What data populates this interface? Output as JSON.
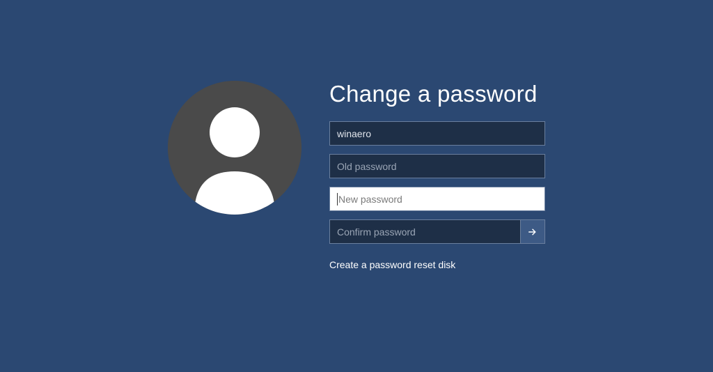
{
  "title": "Change a password",
  "username": "winaero",
  "old_password_placeholder": "Old password",
  "new_password_placeholder": "New password",
  "confirm_password_placeholder": "Confirm password",
  "reset_link": "Create a password reset disk",
  "colors": {
    "background": "#2b4872",
    "field_bg": "#1e2f47",
    "field_active_bg": "#ffffff",
    "submit_bg": "#3d5a85"
  }
}
